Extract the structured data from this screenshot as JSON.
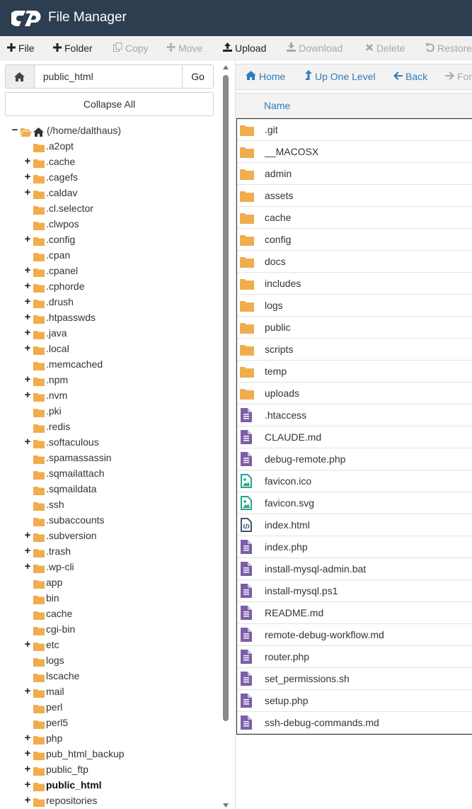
{
  "app": {
    "title": "File Manager"
  },
  "colors": {
    "header_bg": "#2c3e50",
    "link": "#2d7bbd",
    "folder": "#f0ad4e",
    "doc": "#7b5ea7",
    "image": "#27a58a",
    "code": "#46556b"
  },
  "toolbar": {
    "file_label": "File",
    "folder_label": "Folder",
    "copy_label": "Copy",
    "move_label": "Move",
    "upload_label": "Upload",
    "download_label": "Download",
    "delete_label": "Delete",
    "restore_label": "Restore"
  },
  "left": {
    "path_value": "public_html",
    "go_label": "Go",
    "collapse_label": "Collapse All"
  },
  "tree": {
    "root_label": "(/home/dalthaus)",
    "items": [
      {
        "label": ".a2opt",
        "expandable": false
      },
      {
        "label": ".cache",
        "expandable": true
      },
      {
        "label": ".cagefs",
        "expandable": true
      },
      {
        "label": ".caldav",
        "expandable": true
      },
      {
        "label": ".cl.selector",
        "expandable": false
      },
      {
        "label": ".clwpos",
        "expandable": false
      },
      {
        "label": ".config",
        "expandable": true
      },
      {
        "label": ".cpan",
        "expandable": false
      },
      {
        "label": ".cpanel",
        "expandable": true
      },
      {
        "label": ".cphorde",
        "expandable": true
      },
      {
        "label": ".drush",
        "expandable": true
      },
      {
        "label": ".htpasswds",
        "expandable": true
      },
      {
        "label": ".java",
        "expandable": true
      },
      {
        "label": ".local",
        "expandable": true
      },
      {
        "label": ".memcached",
        "expandable": false
      },
      {
        "label": ".npm",
        "expandable": true
      },
      {
        "label": ".nvm",
        "expandable": true
      },
      {
        "label": ".pki",
        "expandable": false
      },
      {
        "label": ".redis",
        "expandable": false
      },
      {
        "label": ".softaculous",
        "expandable": true
      },
      {
        "label": ".spamassassin",
        "expandable": false
      },
      {
        "label": ".sqmailattach",
        "expandable": false
      },
      {
        "label": ".sqmaildata",
        "expandable": false
      },
      {
        "label": ".ssh",
        "expandable": false
      },
      {
        "label": ".subaccounts",
        "expandable": false
      },
      {
        "label": ".subversion",
        "expandable": true
      },
      {
        "label": ".trash",
        "expandable": true
      },
      {
        "label": ".wp-cli",
        "expandable": true
      },
      {
        "label": "app",
        "expandable": false
      },
      {
        "label": "bin",
        "expandable": false
      },
      {
        "label": "cache",
        "expandable": false
      },
      {
        "label": "cgi-bin",
        "expandable": false
      },
      {
        "label": "etc",
        "expandable": true
      },
      {
        "label": "logs",
        "expandable": false
      },
      {
        "label": "lscache",
        "expandable": false
      },
      {
        "label": "mail",
        "expandable": true
      },
      {
        "label": "perl",
        "expandable": false
      },
      {
        "label": "perl5",
        "expandable": false
      },
      {
        "label": "php",
        "expandable": true
      },
      {
        "label": "pub_html_backup",
        "expandable": true
      },
      {
        "label": "public_ftp",
        "expandable": true
      },
      {
        "label": "public_html",
        "expandable": true,
        "active": true
      },
      {
        "label": "repositories",
        "expandable": true
      }
    ]
  },
  "nav": {
    "home_label": "Home",
    "up_label": "Up One Level",
    "back_label": "Back",
    "forward_label": "Forward"
  },
  "table": {
    "name_header": "Name",
    "files": [
      {
        "name": ".git",
        "icon": "folder"
      },
      {
        "name": "__MACOSX",
        "icon": "folder"
      },
      {
        "name": "admin",
        "icon": "folder"
      },
      {
        "name": "assets",
        "icon": "folder"
      },
      {
        "name": "cache",
        "icon": "folder"
      },
      {
        "name": "config",
        "icon": "folder"
      },
      {
        "name": "docs",
        "icon": "folder"
      },
      {
        "name": "includes",
        "icon": "folder"
      },
      {
        "name": "logs",
        "icon": "folder"
      },
      {
        "name": "public",
        "icon": "folder"
      },
      {
        "name": "scripts",
        "icon": "folder"
      },
      {
        "name": "temp",
        "icon": "folder"
      },
      {
        "name": "uploads",
        "icon": "folder"
      },
      {
        "name": ".htaccess",
        "icon": "doc"
      },
      {
        "name": "CLAUDE.md",
        "icon": "doc"
      },
      {
        "name": "debug-remote.php",
        "icon": "doc"
      },
      {
        "name": "favicon.ico",
        "icon": "image"
      },
      {
        "name": "favicon.svg",
        "icon": "image"
      },
      {
        "name": "index.html",
        "icon": "code"
      },
      {
        "name": "index.php",
        "icon": "doc"
      },
      {
        "name": "install-mysql-admin.bat",
        "icon": "doc"
      },
      {
        "name": "install-mysql.ps1",
        "icon": "doc"
      },
      {
        "name": "README.md",
        "icon": "doc"
      },
      {
        "name": "remote-debug-workflow.md",
        "icon": "doc"
      },
      {
        "name": "router.php",
        "icon": "doc"
      },
      {
        "name": "set_permissions.sh",
        "icon": "doc"
      },
      {
        "name": "setup.php",
        "icon": "doc"
      },
      {
        "name": "ssh-debug-commands.md",
        "icon": "doc"
      }
    ]
  }
}
